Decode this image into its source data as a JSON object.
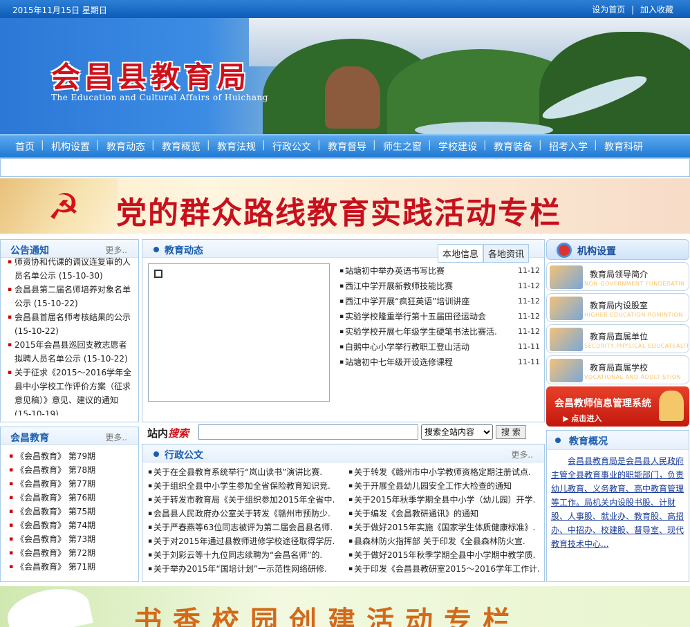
{
  "topbar": {
    "date": "2015年11月15日 星期日",
    "set_home": "设为首页",
    "add_fav": "加入收藏",
    "sep": "|"
  },
  "banner": {
    "logo": "会昌县教育局",
    "subtitle": "The Education and Cultural Affairs of Huichang"
  },
  "nav": [
    "首页",
    "机构设置",
    "教育动态",
    "教育概览",
    "教育法规",
    "行政公文",
    "教育督导",
    "师生之窗",
    "学校建设",
    "教育装备",
    "招考入学",
    "教育科研"
  ],
  "party_banner": {
    "title": "党的群众路线教育实践活动专栏"
  },
  "notice": {
    "title": "公告通知",
    "more": "更多..",
    "items": [
      "师资协和代课的调议连复审的人员名单公示 (15-10-30)",
      "会昌县第二届名师培养对象名单公示 (15-10-22)",
      "会昌县首届名师考核结果的公示 (15-10-22)",
      "2015年会昌县巡回支教志愿者拟聘人员名单公示 (15-10-22)",
      "关于征求《2015～2016学年全县中小学校工作评价方案（征求意见稿）》意见、建议的通知 (15-10-19)"
    ]
  },
  "huichang": {
    "title": "会昌教育",
    "more": "更多..",
    "items": [
      "《会昌教育》 第79期",
      "《会昌教育》 第78期",
      "《会昌教育》 第77期",
      "《会昌教育》 第76期",
      "《会昌教育》 第75期",
      "《会昌教育》 第74期",
      "《会昌教育》 第73期",
      "《会昌教育》 第72期",
      "《会昌教育》 第71期"
    ]
  },
  "news": {
    "title": "教育动态",
    "tabs": [
      "本地信息",
      "各地资讯"
    ],
    "items": [
      {
        "t": "站塘初中举办英语书写比赛",
        "d": "11-12"
      },
      {
        "t": "西江中学开展新教师技能比赛",
        "d": "11-12"
      },
      {
        "t": "西江中学开展“疯狂英语”培训讲座",
        "d": "11-12"
      },
      {
        "t": "实验学校隆重举行第十五届田径运动会",
        "d": "11-12"
      },
      {
        "t": "实验学校开展七年级学生硬笔书法比赛活.",
        "d": "11-12"
      },
      {
        "t": "白鹅中心小学举行教职工登山活动",
        "d": "11-11"
      },
      {
        "t": "站塘初中七年级开设选修课程",
        "d": "11-11"
      }
    ]
  },
  "search": {
    "label_a": "站内",
    "label_b": "搜索",
    "select": "搜索全站内容",
    "button": "搜 索",
    "value": ""
  },
  "docs": {
    "title": "行政公文",
    "more": "更多..",
    "items": [
      "关于在全县教育系统举行“岚山读书”演讲比赛.",
      "关于转发《赣州市中小学教师资格定期注册试点.",
      "关于组织全县中小学生参加全省保险教育知识竞.",
      "关于开展全县幼儿园安全工作大检查的通知",
      "关于转发市教育局《关于组织参加2015年全省中.",
      "关于2015年秋季学期全县中小学（幼儿园）开学.",
      "会昌县人民政府办公室关于转发《赣州市预防少.",
      "关于编发《会昌教研通讯》的通知",
      "关于严春燕等63位同志被评为第二届会昌县名师.",
      "关于做好2015年实施《国家学生体质健康标准》.",
      "关于对2015年通过县教师进修学校途径取得学历.",
      "县森林防火指挥部 关于印发《全县森林防火宣.",
      "关于刘彩云等十九位同志续聘为“会昌名师”的.",
      "关于做好2015年秋季学期全县中小学期中教学质.",
      "关于举办2015年“国培计划”一示范性网络研修.",
      "关于印发《会昌县教研室2015～2016学年工作计."
    ]
  },
  "org": {
    "title": "机构设置",
    "items": [
      {
        "name": "教育局领导简介",
        "en": "NON-GOVERNMENT FUNDEDATIN"
      },
      {
        "name": "教育局内设股室",
        "en": "HIGHER EDUCATION ROMINTION"
      },
      {
        "name": "教育局直属单位",
        "en": "SECURITY,PHYSICAL EDUCATEALTH"
      },
      {
        "name": "教育局直属学校",
        "en": "VOCATIONAL AND ADULT STION"
      }
    ]
  },
  "teacher": {
    "title": "会昌教师信息管理系统",
    "sub": "▶ 点击进入"
  },
  "overview": {
    "title": "教育概况",
    "text": "会昌县教育局是会昌县人民政府主管全县教育事业的职能部门，负责幼儿教育、义务教育、高中教育管理等工作。局机关内设股书股、计财股、人事股、就业办、教育股、高招办、中招办、校建股、督导室、现代教育技术中心..."
  },
  "books_banner": {
    "title": "书香校园创建活动专栏"
  }
}
